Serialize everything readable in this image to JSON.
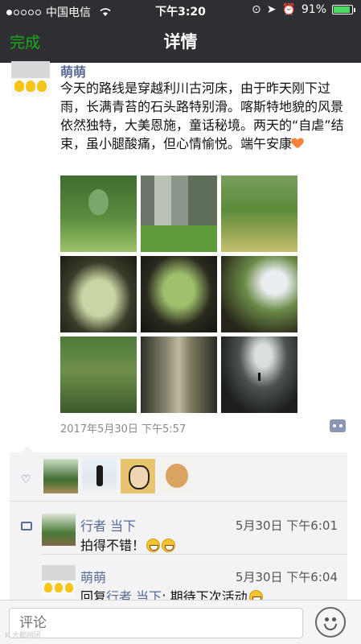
{
  "status_bar": {
    "carrier": "中国电信",
    "time": "下午3:20",
    "battery": "91%",
    "battery_level": 0.91
  },
  "nav": {
    "done_label": "完成",
    "title": "详情"
  },
  "post": {
    "author": "萌萌",
    "text": "今天的路线是穿越利川古河床，由于昨天刚下过雨，长满青苔的石头路特别滑。喀斯特地貌的风景依然独特，大美恩施，童话秘境。两天的“自虐”结束，虽小腿酸痛，但心情愉悦。端午安康",
    "emoji": "heart",
    "photo_count": 9,
    "timestamp": "2017年5月30日 下午5:57"
  },
  "likes": {
    "icon": "heart-outline-icon",
    "likers": [
      "liker-1",
      "liker-2",
      "liker-3",
      "liker-4"
    ]
  },
  "comments": [
    {
      "name": "行者 当下",
      "time": "5月30日 下午6:01",
      "text": "拍得不错！",
      "emoji": "grin x2"
    },
    {
      "name": "萌萌",
      "time": "5月30日 下午6:04",
      "reply_prefix": "回复",
      "reply_to": "行者 当下",
      "text": ": 期待下次活动",
      "emoji": "grin"
    }
  ],
  "input": {
    "placeholder": "评论"
  },
  "watermark": "K 大都网团"
}
